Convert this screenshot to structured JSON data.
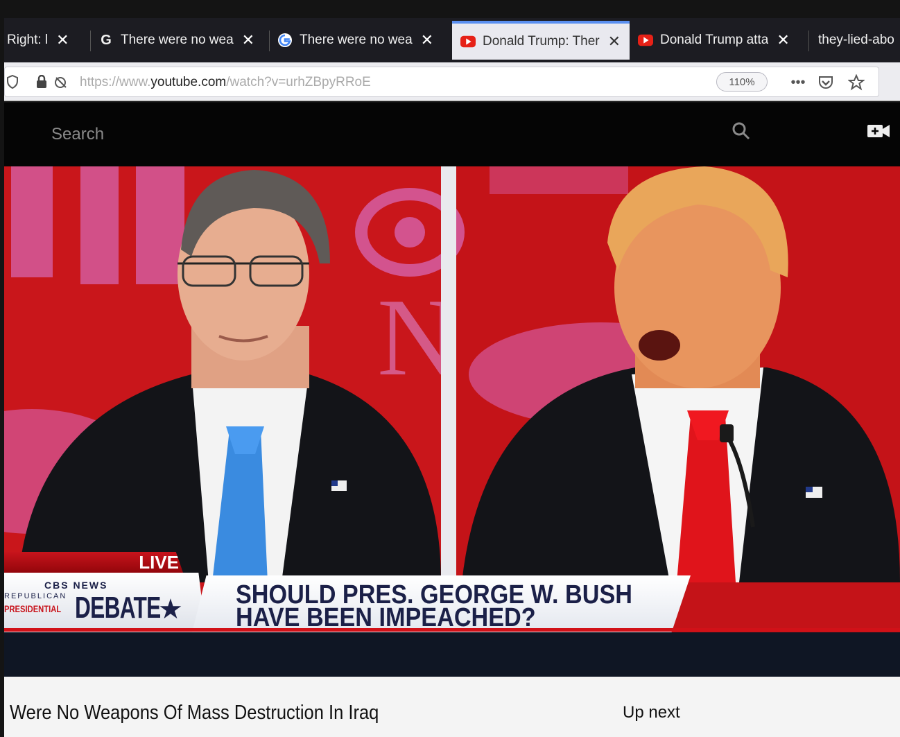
{
  "browser": {
    "tabs": [
      {
        "label": "Right: l",
        "icon": "none",
        "active": false
      },
      {
        "label": "There were no wea",
        "icon": "g-icon",
        "active": false
      },
      {
        "label": "There were no wea",
        "icon": "google-icon",
        "active": false
      },
      {
        "label": "Donald Trump: Ther",
        "icon": "youtube-icon",
        "active": true
      },
      {
        "label": "Donald Trump atta",
        "icon": "youtube-icon",
        "active": false
      },
      {
        "label": "they-lied-abo",
        "icon": "none",
        "active": false
      }
    ],
    "tab_close": "✕",
    "url_prefix": "https://www.",
    "url_domain": "youtube.com",
    "url_path": "/watch?v=urhZBpyRRoE",
    "zoom": "110%"
  },
  "youtube": {
    "search_placeholder": "Search"
  },
  "video": {
    "live_label": "LIVE",
    "network": "CBS NEWS",
    "debate_line1": "REPUBLICAN",
    "debate_line2": "PRESIDENTIAL",
    "debate_word": "DEBATE",
    "headline": "SHOULD PRES. GEORGE W. BUSH HAVE BEEN IMPEACHED?",
    "colors": {
      "stage_red": "#c9161b",
      "tie_left": "#3a8be0",
      "tie_right": "#e0141b",
      "navy": "#1b2048"
    }
  },
  "page": {
    "video_title": "Were No Weapons Of Mass Destruction In Iraq",
    "up_next": "Up next"
  }
}
